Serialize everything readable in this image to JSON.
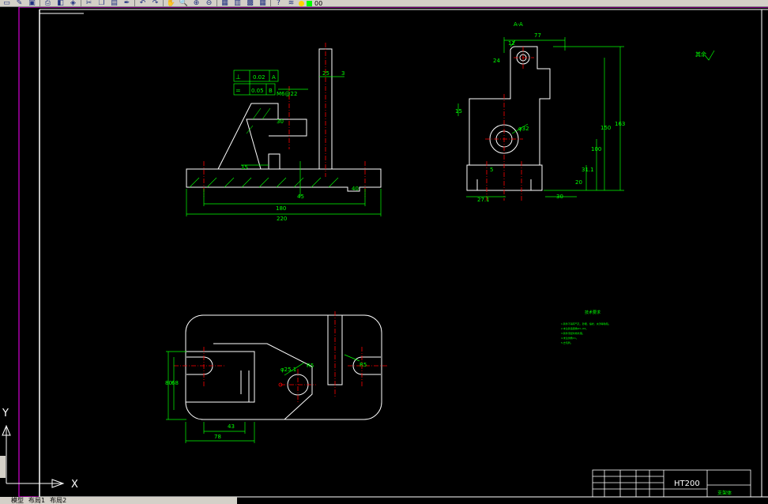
{
  "toolbar": {
    "buttons": [
      {
        "name": "new-icon",
        "glyph": "▭"
      },
      {
        "name": "open-icon",
        "glyph": "✎"
      },
      {
        "name": "save-icon",
        "glyph": "▣"
      },
      {
        "name": "plot-icon",
        "glyph": "⎙"
      },
      {
        "name": "preview-icon",
        "glyph": "◧"
      },
      {
        "name": "publish-icon",
        "glyph": "◈"
      },
      {
        "name": "cut-icon",
        "glyph": "✂"
      },
      {
        "name": "copy-icon",
        "glyph": "❐"
      },
      {
        "name": "paste-icon",
        "glyph": "▤"
      },
      {
        "name": "match-prop-icon",
        "glyph": "✒"
      },
      {
        "name": "undo-icon",
        "glyph": "↶"
      },
      {
        "name": "redo-icon",
        "glyph": "↷"
      },
      {
        "name": "pan-icon",
        "glyph": "✋"
      },
      {
        "name": "zoom-icon",
        "glyph": "🔍"
      },
      {
        "name": "zoom-window-icon",
        "glyph": "⊕"
      },
      {
        "name": "zoom-prev-icon",
        "glyph": "⊖"
      },
      {
        "name": "properties-icon",
        "glyph": "▦"
      },
      {
        "name": "design-center-icon",
        "glyph": "▥"
      },
      {
        "name": "tool-palette-icon",
        "glyph": "▩"
      },
      {
        "name": "calculator-icon",
        "glyph": "▦"
      },
      {
        "name": "help-icon",
        "glyph": "?"
      },
      {
        "name": "layers-icon",
        "glyph": "≋"
      }
    ],
    "layer_value": "00",
    "colors": {
      "bulb": "#ffd200",
      "sun": "#ffd200",
      "layer_color": "#00ff00",
      "toolbar_bg": "#d4d0c8"
    }
  },
  "drawing": {
    "colors": {
      "background": "#000000",
      "outline": "#ffffff",
      "dimension": "#00ff00",
      "center": "#ff0000",
      "frame": "#ff00ff"
    },
    "front_view": {
      "datum_frame_1": {
        "symbol": "⊥",
        "value": "0.02",
        "datum": "A"
      },
      "datum_frame_2": {
        "symbol": "=",
        "value": "0.05",
        "datum": "B"
      },
      "dim_overall_width": "220",
      "dim_hole_spacing": "180",
      "dim_top_width": "25",
      "dim_top_right": "3",
      "dim_rib": "15",
      "dim_bore": "M6@22",
      "dim_height": "45",
      "dim_30": "30",
      "dim_right": "40"
    },
    "side_view": {
      "dim_top_width": "77",
      "dim_offset": "12",
      "dim_top_hole": "24",
      "dim_overall_height": "163",
      "dim_mid_height": "150",
      "dim_center_height": "100",
      "dim_lower": "31.1",
      "dim_base": "20",
      "dim_left_box": "15",
      "dim_base_width": "30",
      "dim_bottom_left": "27.1",
      "dim_bore": "φ32",
      "dim_slot": "5"
    },
    "top_view": {
      "dim_length_78": "78",
      "dim_length_43": "43",
      "dim_height_80": "80",
      "dim_height_68": "68",
      "dim_bore": "φ25.1",
      "dim_slot": "R5",
      "dim_right_slot": "R5"
    },
    "tech_notes_title": "技术要求",
    "tech_notes": [
      "1.铸件不得有气孔、砂眼、缩松、夹渣等缺陷。",
      "2.未注铸造圆角R3~R5。",
      "3.铸件须经时效处理。",
      "4.未注倒角C1。",
      "5.去毛刺。"
    ],
    "roughness_note": "其余",
    "section_label": "A-A",
    "title_block": {
      "material": "HT200",
      "part_name": "支架体"
    },
    "axis": {
      "y_label": "Y",
      "x_label": "X"
    }
  },
  "tabs": {
    "model": "模型",
    "layout1": "布局1",
    "layout2": "布局2"
  }
}
